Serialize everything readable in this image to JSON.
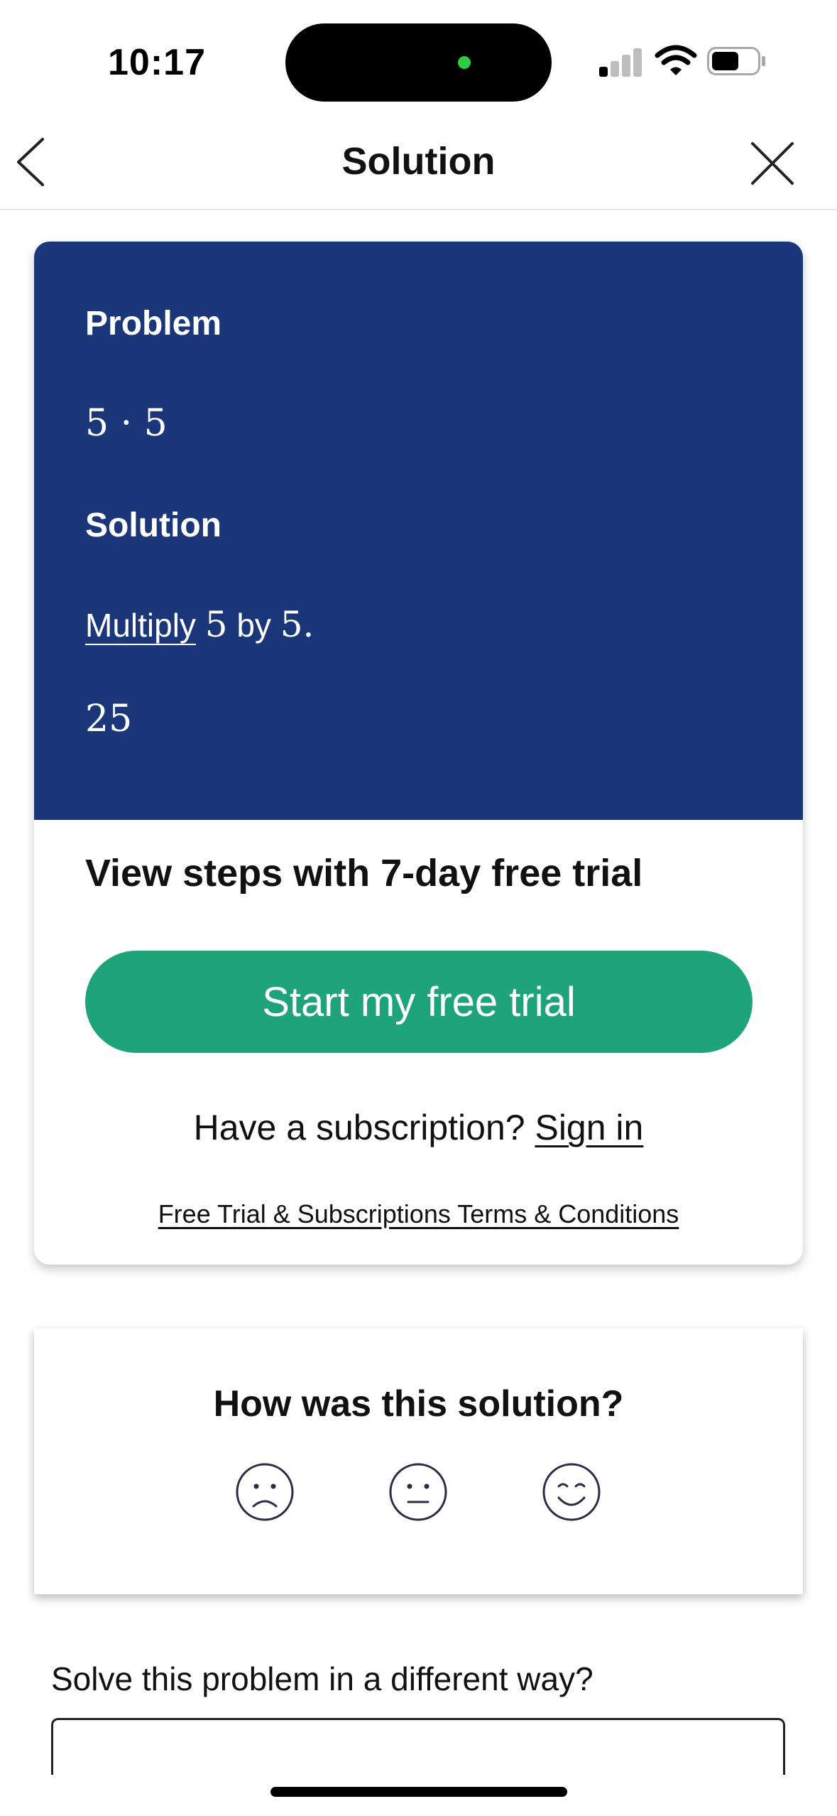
{
  "status_bar": {
    "time": "10:17",
    "signal_icon": "cellular-signal-icon",
    "wifi_icon": "wifi-icon",
    "battery_icon": "battery-icon",
    "battery_level": 0.6
  },
  "nav": {
    "back_icon": "chevron-left-icon",
    "title": "Solution",
    "close_icon": "close-icon"
  },
  "solution_card": {
    "problem_label": "Problem",
    "problem_expression": "5 · 5",
    "solution_label": "Solution",
    "step": {
      "link_text": "Multiply",
      "first_number": "5",
      "connector": "by",
      "second_number": "5."
    },
    "result": "25",
    "background_color": "#1b377a"
  },
  "trial": {
    "heading": "View steps with 7-day free trial",
    "button_label": "Start my free trial",
    "button_color": "#1fa379",
    "subscription_prompt": "Have a subscription?",
    "sign_in_label": "Sign in",
    "terms_link": "Free Trial & Subscriptions Terms & Conditions"
  },
  "feedback": {
    "title": "How was this solution?",
    "options": [
      "sad-face-icon",
      "neutral-face-icon",
      "happy-face-icon"
    ]
  },
  "alternate": {
    "label": "Solve this problem in a different way?"
  }
}
